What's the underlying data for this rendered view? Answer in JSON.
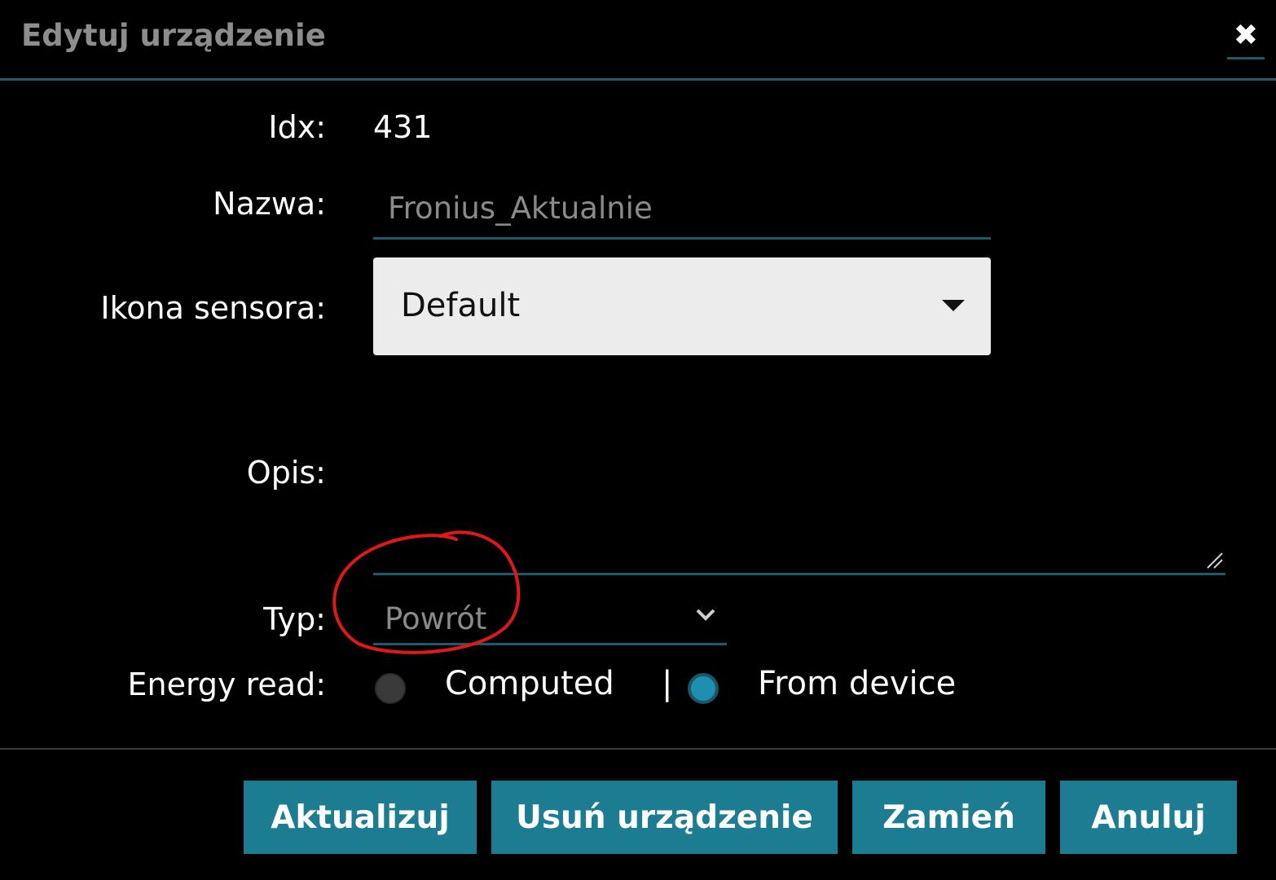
{
  "dialog": {
    "title": "Edytuj urządzenie",
    "close_icon": "close-icon"
  },
  "fields": {
    "idx": {
      "label": "Idx:",
      "value": "431"
    },
    "name": {
      "label": "Nazwa:",
      "value": "Fronius_Aktualnie"
    },
    "sensor_icon": {
      "label": "Ikona sensora:",
      "value": "Default"
    },
    "description": {
      "label": "Opis:",
      "value": ""
    },
    "type": {
      "label": "Typ:",
      "value": "Powrót"
    },
    "energy_read": {
      "label": "Energy read:",
      "options": [
        {
          "label": "Computed",
          "selected": false
        },
        {
          "label": "From device",
          "selected": true
        }
      ],
      "separator": "|"
    }
  },
  "buttons": {
    "update": "Aktualizuj",
    "delete": "Usuń urządzenie",
    "replace": "Zamień",
    "cancel": "Anuluj"
  },
  "colors": {
    "accent": "#1b7c92",
    "radio_selected": "#1d8fb0",
    "annotation": "#e01818"
  }
}
